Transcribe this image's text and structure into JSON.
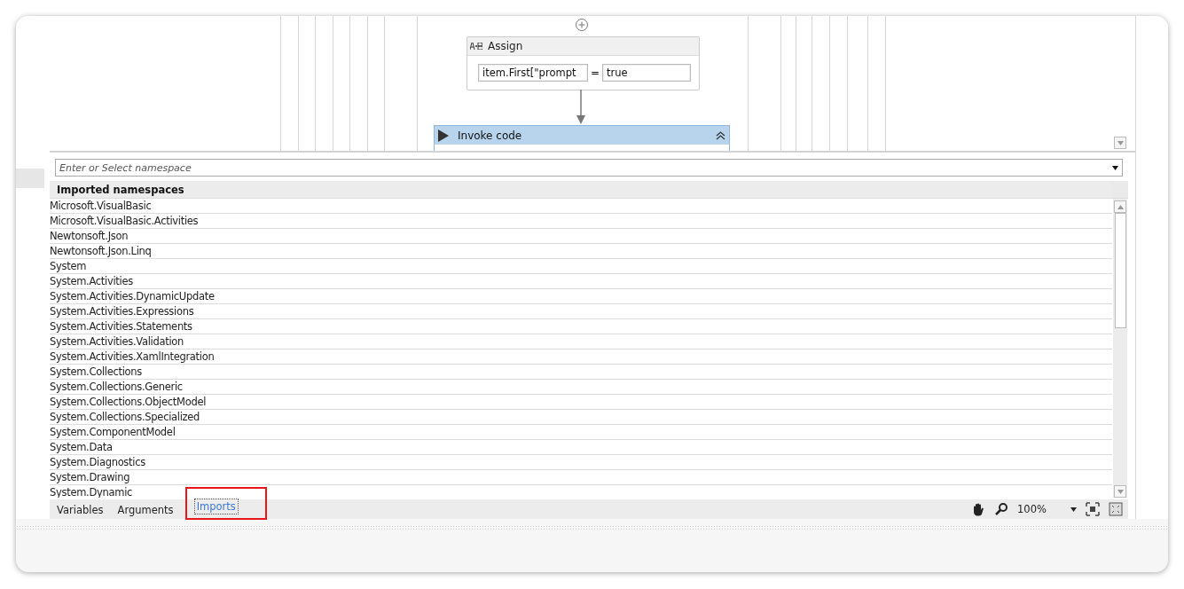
{
  "designer": {
    "assign": {
      "title": "Assign",
      "to": "item.First[\"prompt",
      "operator": "=",
      "value": "true"
    },
    "invoke": {
      "title": "Invoke code",
      "expanded": true
    }
  },
  "namespace_field": {
    "placeholder": "Enter or Select namespace"
  },
  "table": {
    "columns": [
      "Imported namespaces"
    ],
    "rows": [
      "Microsoft.VisualBasic",
      "Microsoft.VisualBasic.Activities",
      "Newtonsoft.Json",
      "Newtonsoft.Json.Linq",
      "System",
      "System.Activities",
      "System.Activities.DynamicUpdate",
      "System.Activities.Expressions",
      "System.Activities.Statements",
      "System.Activities.Validation",
      "System.Activities.XamlIntegration",
      "System.Collections",
      "System.Collections.Generic",
      "System.Collections.ObjectModel",
      "System.Collections.Specialized",
      "System.ComponentModel",
      "System.Data",
      "System.Diagnostics",
      "System.Drawing",
      "System.Dynamic"
    ]
  },
  "tabs": [
    {
      "label": "Variables",
      "selected": false,
      "highlighted": false
    },
    {
      "label": "Arguments",
      "selected": false,
      "highlighted": false
    },
    {
      "label": "Imports",
      "selected": true,
      "highlighted": true
    }
  ],
  "zoom": "100%"
}
